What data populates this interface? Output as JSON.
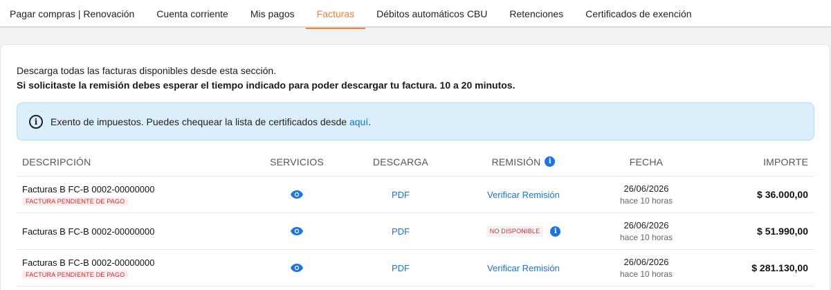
{
  "tabs": [
    {
      "label": "Pagar compras | Renovación",
      "active": false
    },
    {
      "label": "Cuenta corriente",
      "active": false
    },
    {
      "label": "Mis pagos",
      "active": false
    },
    {
      "label": "Facturas",
      "active": true
    },
    {
      "label": "Débitos automáticos CBU",
      "active": false
    },
    {
      "label": "Retenciones",
      "active": false
    },
    {
      "label": "Certificados de exención",
      "active": false
    }
  ],
  "intro": {
    "line1": "Descarga todas las facturas disponibles desde esta sección.",
    "line2": "Si solicitaste la remisión debes esperar el tiempo indicado para poder descargar tu factura. 10 a 20 minutos."
  },
  "alert": {
    "text": "Exento de impuestos. Puedes chequear la lista de certificados desde ",
    "link": "aquí",
    "suffix": ".",
    "icon": "info-outline-icon"
  },
  "table": {
    "headers": {
      "descripcion": "DESCRIPCIÓN",
      "servicios": "SERVICIOS",
      "descarga": "DESCARGA",
      "remision": "REMISIÓN",
      "fecha": "FECHA",
      "importe": "IMPORTE"
    },
    "rows": [
      {
        "descripcion": "Facturas B FC-B 0002-00000000",
        "badge": "FACTURA PENDIENTE DE PAGO",
        "descarga": "PDF",
        "remision": "Verificar Remisión",
        "fecha": "26/06/2026",
        "fecha_rel": "hace 10 horas",
        "importe": "$ 36.000,00"
      },
      {
        "descripcion": "Facturas B FC-B 0002-00000000",
        "badge": "",
        "descarga": "PDF",
        "remision": "NO DISPONIBLE",
        "fecha": "26/06/2026",
        "fecha_rel": "hace 10 horas",
        "importe": "$ 51.990,00"
      },
      {
        "descripcion": "Facturas B FC-B 0002-00000000",
        "badge": "FACTURA PENDIENTE DE PAGO",
        "descarga": "PDF",
        "remision": "Verificar Remisión",
        "fecha": "26/06/2026",
        "fecha_rel": "hace 10 horas",
        "importe": "$ 281.130,00"
      }
    ]
  },
  "colors": {
    "accent": "#f0803c",
    "link": "#1a73e8",
    "alert_bg": "#dbeefb",
    "danger": "#d32f2f"
  }
}
